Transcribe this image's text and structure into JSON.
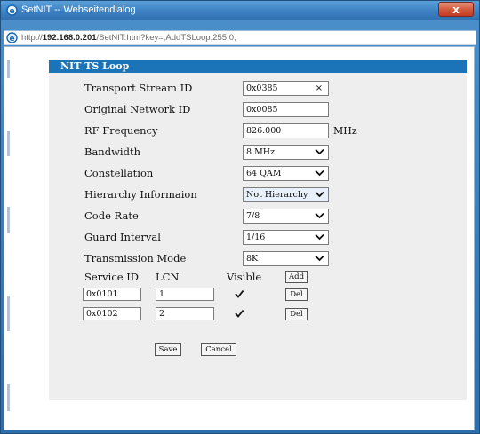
{
  "window": {
    "title": "SetNIT -- Webseitendialog",
    "close_label": "x"
  },
  "address": {
    "prefix": "http://",
    "host": "192.168.0.201",
    "path": "/SetNIT.htm?key=;AddTSLoop;255;0;"
  },
  "panel": {
    "title": "NIT TS Loop",
    "fields": {
      "transport_stream_id": {
        "label": "Transport Stream ID",
        "value": "0x0385",
        "clear": "×"
      },
      "original_network_id": {
        "label": "Original Network ID",
        "value": "0x0085"
      },
      "rf_frequency": {
        "label": "RF Frequency",
        "value": "826.000",
        "unit": "MHz"
      },
      "bandwidth": {
        "label": "Bandwidth",
        "value": "8 MHz"
      },
      "constellation": {
        "label": "Constellation",
        "value": "64 QAM"
      },
      "hierarchy": {
        "label": "Hierarchy Informaion",
        "value": "Not Hierarchy"
      },
      "code_rate": {
        "label": "Code Rate",
        "value": "7/8"
      },
      "guard_interval": {
        "label": "Guard Interval",
        "value": "1/16"
      },
      "transmission_mode": {
        "label": "Transmission Mode",
        "value": "8K"
      }
    },
    "services": {
      "headers": {
        "service_id": "Service ID",
        "lcn": "LCN",
        "visible": "Visible"
      },
      "add_label": "Add",
      "rows": [
        {
          "service_id": "0x0101",
          "lcn": "1",
          "visible": true,
          "del_label": "Del"
        },
        {
          "service_id": "0x0102",
          "lcn": "2",
          "visible": true,
          "del_label": "Del"
        }
      ]
    },
    "save_label": "Save",
    "cancel_label": "Cancel"
  }
}
